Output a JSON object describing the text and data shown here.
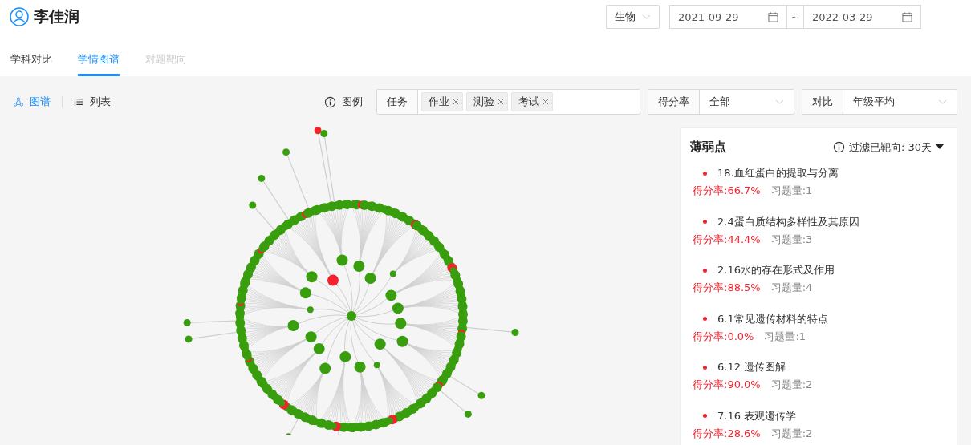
{
  "user": {
    "name": "李佳润"
  },
  "subject_select": {
    "value": "生物"
  },
  "date_range": {
    "start": "2021-09-29",
    "separator": "~",
    "end": "2022-03-29"
  },
  "tabs": [
    {
      "label": "学科对比",
      "selected": false,
      "disabled": false
    },
    {
      "label": "学情图谱",
      "selected": true,
      "disabled": false
    },
    {
      "label": "对题靶向",
      "selected": false,
      "disabled": true
    }
  ],
  "view_toggle": [
    {
      "label": "图谱",
      "selected": true,
      "kind": "graph"
    },
    {
      "label": "列表",
      "selected": false,
      "kind": "list"
    }
  ],
  "legend": {
    "label": "图例"
  },
  "task_filter": {
    "label": "任务",
    "tags": [
      "作业",
      "测验",
      "考试"
    ]
  },
  "score_filter": {
    "label": "得分率",
    "value": "全部"
  },
  "compare_filter": {
    "label": "对比",
    "value": "年级平均"
  },
  "weak_points": {
    "title": "薄弱点",
    "filter": "过滤已靶向: 30天",
    "items": [
      {
        "name": "18.血红蛋白的提取与分离",
        "score": "得分率:66.7%",
        "count": "习题量:1"
      },
      {
        "name": "2.4蛋白质结构多样性及其原因",
        "score": "得分率:44.4%",
        "count": "习题量:3"
      },
      {
        "name": "2.16水的存在形式及作用",
        "score": "得分率:88.5%",
        "count": "习题量:4"
      },
      {
        "name": "6.1常见遗传材料的特点",
        "score": "得分率:0.0%",
        "count": "习题量:1"
      },
      {
        "name": "6.12 遗传图解",
        "score": "得分率:90.0%",
        "count": "习题量:2"
      },
      {
        "name": "7.16 表观遗传学",
        "score": "得分率:28.6%",
        "count": "习题量:2"
      }
    ]
  }
}
